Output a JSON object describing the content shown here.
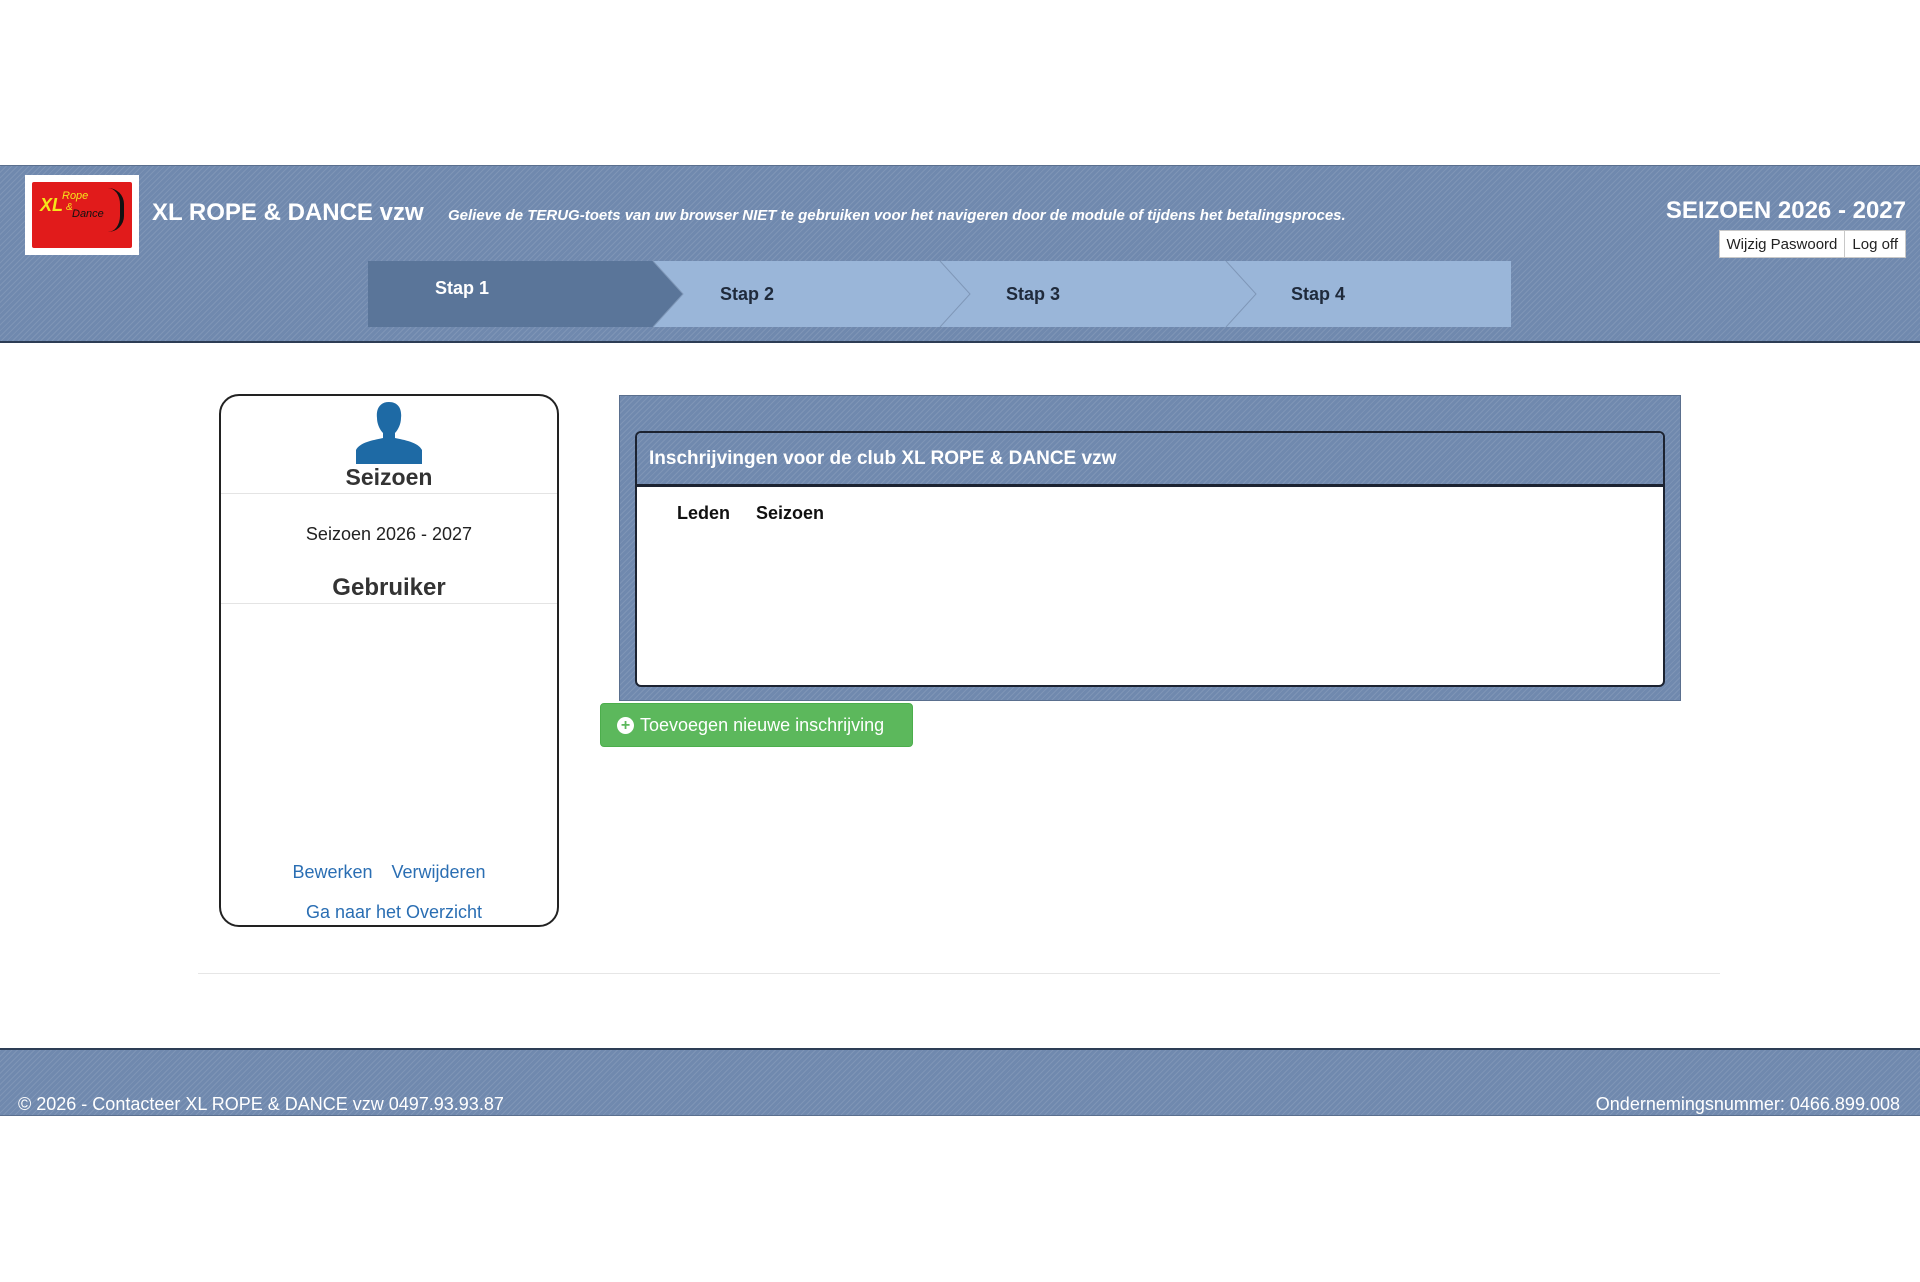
{
  "header": {
    "club_name": "XL ROPE & DANCE vzw",
    "warning": "Gelieve de TERUG-toets van uw browser NIET te gebruiken voor het navigeren door de module of tijdens het betalingsproces.",
    "season": "SEIZOEN 2026 - 2027",
    "change_password": "Wijzig Paswoord",
    "log_off": "Log off",
    "logo": {
      "xl": "XL",
      "rope": "Rope",
      "amp": "&",
      "dance": "Dance"
    }
  },
  "steps": [
    {
      "label": "Stap 1",
      "active": true
    },
    {
      "label": "Stap 2",
      "active": false
    },
    {
      "label": "Stap 3",
      "active": false
    },
    {
      "label": "Stap 4",
      "active": false
    }
  ],
  "sidebar": {
    "title": "Seizoen",
    "season": "Seizoen 2026 - 2027",
    "user_title": "Gebruiker",
    "edit": "Bewerken",
    "delete": "Verwijderen",
    "overview": "Ga naar het Overzicht"
  },
  "panel": {
    "title": "Inschrijvingen voor de club XL ROPE & DANCE vzw",
    "columns": [
      "Leden",
      "Seizoen"
    ]
  },
  "add_button": "Toevoegen nieuwe inschrijving",
  "footer": {
    "left": "© 2026 - Contacteer XL ROPE & DANCE vzw 0497.93.93.87",
    "right": "Ondernemingsnummer: 0466.899.008"
  },
  "colors": {
    "header_bg": "#7089ae",
    "step_active": "#5a7599",
    "step_inactive": "#9ab6d9",
    "link": "#2a6eb3",
    "success": "#5cb85c",
    "avatar": "#1e6aa5"
  }
}
